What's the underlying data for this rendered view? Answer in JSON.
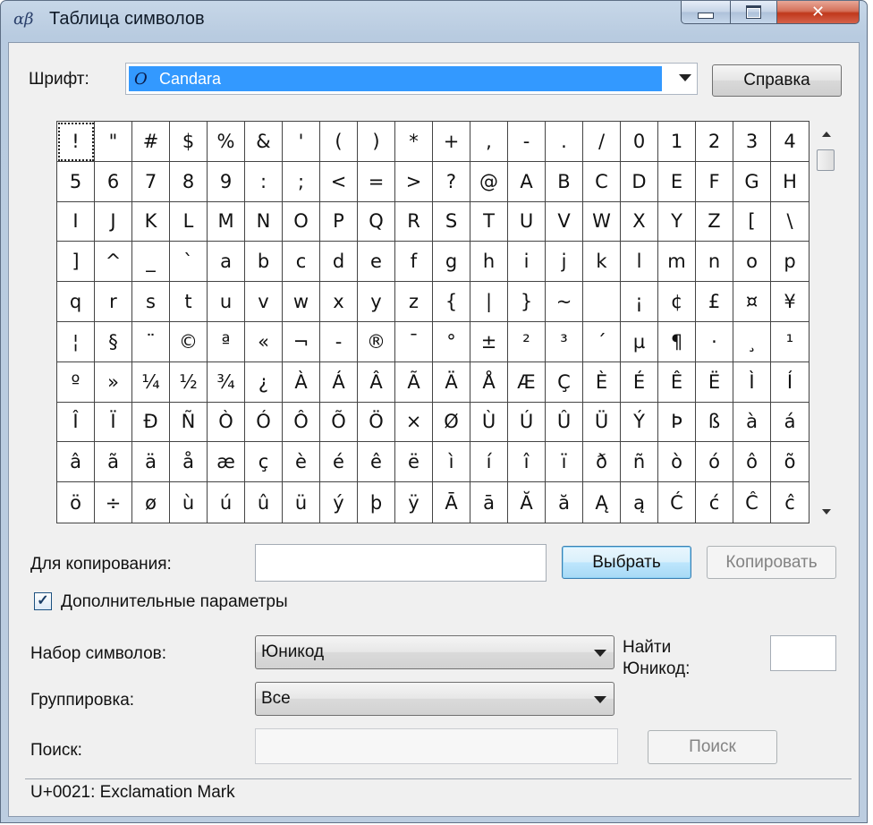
{
  "window": {
    "title": "Таблица символов",
    "icon": "charmap-icon",
    "controls": {
      "minimize": "minimize-icon",
      "maximize": "maximize-icon",
      "close": "✕"
    }
  },
  "font": {
    "label": "Шрифт:",
    "selected": "Candara",
    "help_button": "Справка"
  },
  "grid": {
    "selected_index": 0,
    "rows": [
      [
        "!",
        "\"",
        "#",
        "$",
        "%",
        "&",
        "'",
        "(",
        ")",
        "*",
        "+",
        ",",
        "-",
        ".",
        "/",
        "0",
        "1",
        "2",
        "3",
        "4"
      ],
      [
        "5",
        "6",
        "7",
        "8",
        "9",
        ":",
        ";",
        "<",
        "=",
        ">",
        "?",
        "@",
        "A",
        "B",
        "C",
        "D",
        "E",
        "F",
        "G",
        "H"
      ],
      [
        "I",
        "J",
        "K",
        "L",
        "M",
        "N",
        "O",
        "P",
        "Q",
        "R",
        "S",
        "T",
        "U",
        "V",
        "W",
        "X",
        "Y",
        "Z",
        "[",
        "\\"
      ],
      [
        "]",
        "^",
        "_",
        "`",
        "a",
        "b",
        "c",
        "d",
        "e",
        "f",
        "g",
        "h",
        "i",
        "j",
        "k",
        "l",
        "m",
        "n",
        "o",
        "p"
      ],
      [
        "q",
        "r",
        "s",
        "t",
        "u",
        "v",
        "w",
        "x",
        "y",
        "z",
        "{",
        "|",
        "}",
        "~",
        " ",
        "¡",
        "¢",
        "£",
        "¤",
        "¥"
      ],
      [
        "¦",
        "§",
        "¨",
        "©",
        "ª",
        "«",
        "¬",
        "-",
        "®",
        "¯",
        "°",
        "±",
        "²",
        "³",
        "´",
        "µ",
        "¶",
        "·",
        "¸",
        "¹"
      ],
      [
        "º",
        "»",
        "¼",
        "½",
        "¾",
        "¿",
        "À",
        "Á",
        "Â",
        "Ã",
        "Ä",
        "Å",
        "Æ",
        "Ç",
        "È",
        "É",
        "Ê",
        "Ë",
        "Ì",
        "Í"
      ],
      [
        "Î",
        "Ï",
        "Ð",
        "Ñ",
        "Ò",
        "Ó",
        "Ô",
        "Õ",
        "Ö",
        "×",
        "Ø",
        "Ù",
        "Ú",
        "Û",
        "Ü",
        "Ý",
        "Þ",
        "ß",
        "à",
        "á"
      ],
      [
        "â",
        "ã",
        "ä",
        "å",
        "æ",
        "ç",
        "è",
        "é",
        "ê",
        "ë",
        "ì",
        "í",
        "î",
        "ï",
        "ð",
        "ñ",
        "ò",
        "ó",
        "ô",
        "õ"
      ],
      [
        "ö",
        "÷",
        "ø",
        "ù",
        "ú",
        "û",
        "ü",
        "ý",
        "þ",
        "ÿ",
        "Ā",
        "ā",
        "Ă",
        "ă",
        "Ą",
        "ą",
        "Ć",
        "ć",
        "Ĉ",
        "ĉ"
      ]
    ]
  },
  "copy": {
    "label": "Для копирования:",
    "value": "",
    "select_button": "Выбрать",
    "copy_button": "Копировать"
  },
  "advanced": {
    "checkbox_label": "Дополнительные параметры",
    "checked": true,
    "charset_label": "Набор символов:",
    "charset_value": "Юникод",
    "find_unicode_label_1": "Найти",
    "find_unicode_label_2": "Юникод:",
    "find_unicode_value": "",
    "grouping_label": "Группировка:",
    "grouping_value": "Все",
    "search_label": "Поиск:",
    "search_value": "",
    "search_button": "Поиск"
  },
  "status": "U+0021: Exclamation Mark"
}
